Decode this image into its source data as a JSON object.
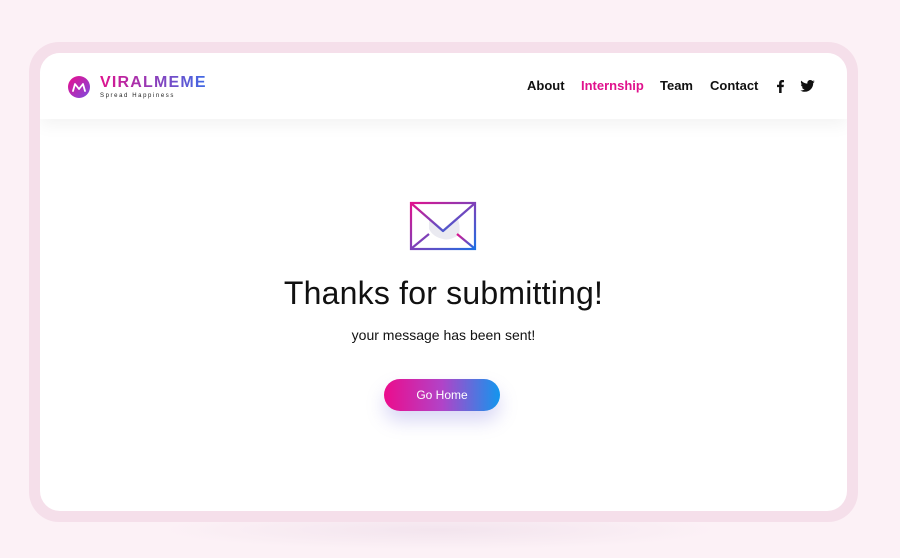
{
  "brand": {
    "name": "VIRALMEME",
    "tagline": "Spread Happiness",
    "logo_mark_text": "M",
    "gradient_start": "#e0128d",
    "gradient_end": "#3d6ae6"
  },
  "nav": {
    "items": [
      {
        "label": "About",
        "active": false
      },
      {
        "label": "Internship",
        "active": true
      },
      {
        "label": "Team",
        "active": false
      },
      {
        "label": "Contact",
        "active": false
      }
    ],
    "social": [
      {
        "icon": "facebook-icon"
      },
      {
        "icon": "twitter-icon"
      }
    ],
    "active_color": "#e0128d"
  },
  "confirmation": {
    "icon": "envelope-icon",
    "title": "Thanks for submitting!",
    "message": "your message has been sent!",
    "button_label": "Go Home"
  },
  "colors": {
    "page_bg": "#fcf1f6",
    "frame": "#f5dfea",
    "button_start": "#ec0c8c",
    "button_end": "#1296ee"
  }
}
